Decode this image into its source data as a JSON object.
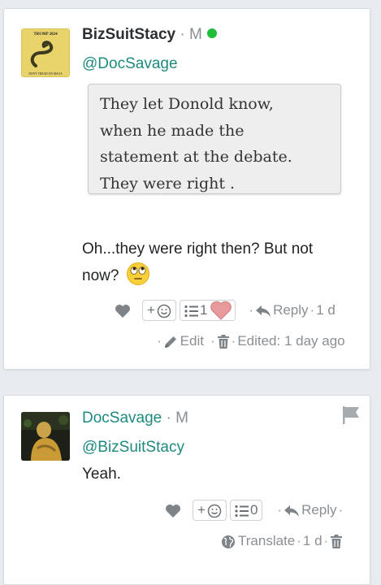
{
  "posts": [
    {
      "username": "BizSuitStacy",
      "badge": "M",
      "online_color": "#1fbf3a",
      "avatar": {
        "top": "TRUMP 2024",
        "bottom": "DON'T TREAD ON MAGA"
      },
      "mention": "@DocSavage",
      "quote": [
        "They let Donold know,",
        "when he made the",
        "statement at the debate.",
        "They were right ."
      ],
      "body_lines": [
        "Oh...they were right then? But not",
        "now?"
      ],
      "body_emoji": "eye-roll-emoji",
      "list_count": "1",
      "reply_label": "Reply",
      "time": "1 d",
      "edit_label": "Edit",
      "edited_label": "Edited: 1 day ago"
    },
    {
      "username": "DocSavage",
      "badge": "M",
      "mention": "@BizSuitStacy",
      "body": "Yeah.",
      "list_count": "0",
      "reply_label": "Reply",
      "translate_label": "Translate",
      "time": "1 d"
    }
  ],
  "colors": {
    "accent": "#1e8a7e",
    "muted": "#8a8f94"
  }
}
